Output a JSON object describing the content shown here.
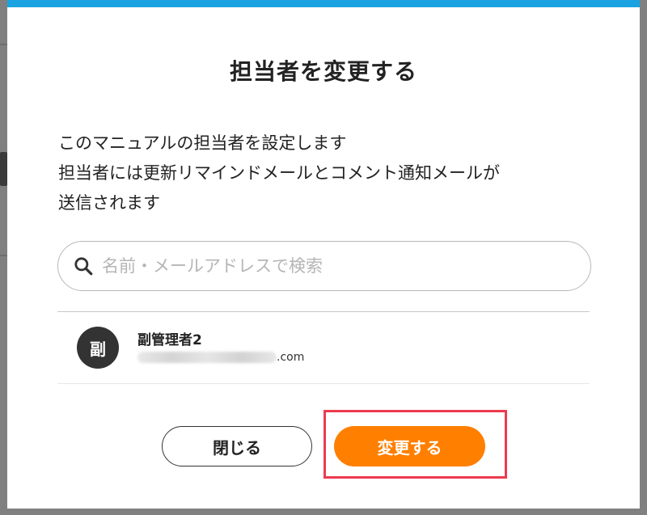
{
  "modal": {
    "title": "担当者を変更する",
    "description": [
      "このマニュアルの担当者を設定します",
      "担当者には更新リマインドメールとコメント通知メールが",
      "送信されます"
    ]
  },
  "search": {
    "placeholder": "名前・メールアドレスで検索",
    "value": "",
    "icon": "search-icon"
  },
  "users": [
    {
      "avatar_text": "副",
      "name": "副管理者2",
      "email_domain": ".com"
    }
  ],
  "buttons": {
    "close_label": "閉じる",
    "submit_label": "変更する"
  },
  "colors": {
    "accent_top_bar": "#1aa3e0",
    "submit_button": "#ff7f00",
    "highlight_border": "#ec3b4f",
    "avatar_bg": "#333333"
  }
}
